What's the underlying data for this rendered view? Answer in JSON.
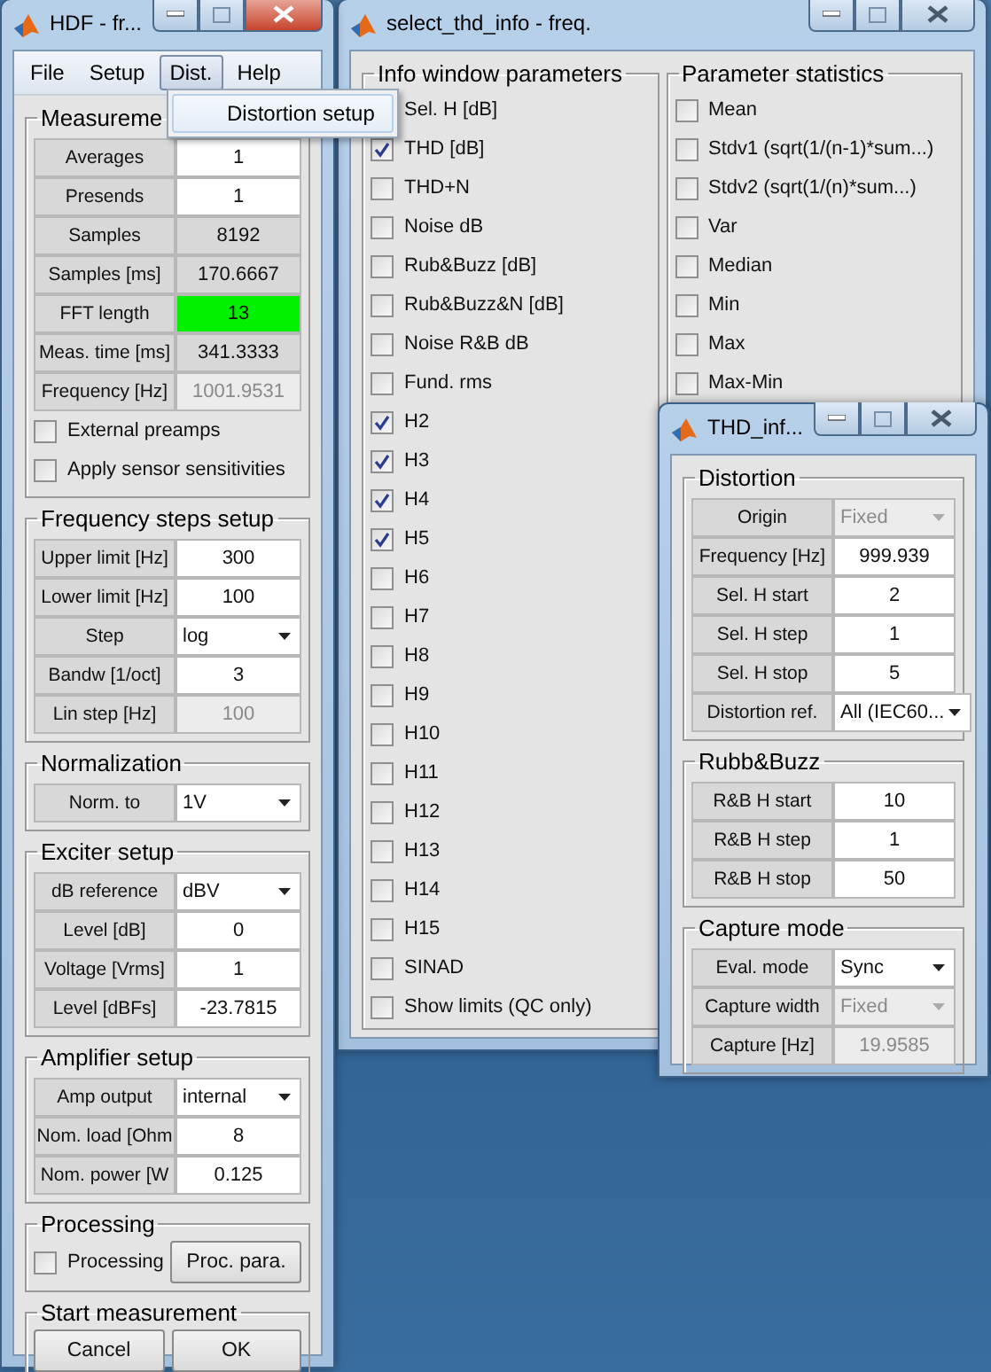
{
  "windows": [
    {
      "kind": "main",
      "title": "HDF - fr...",
      "active": true,
      "menu": [
        {
          "label": "File",
          "selected": false
        },
        {
          "label": "Setup",
          "selected": false
        },
        {
          "label": "Dist.",
          "selected": true
        },
        {
          "label": "Help",
          "selected": false
        }
      ],
      "dropdown": [
        "Distortion setup"
      ],
      "panels": [
        {
          "title": "Measureme",
          "items": [
            {
              "kind": "edit",
              "label": "Averages",
              "value": "1"
            },
            {
              "kind": "edit",
              "label": "Presends",
              "value": "1"
            },
            {
              "kind": "text",
              "label": "Samples",
              "value": "8192"
            },
            {
              "kind": "text",
              "label": "Samples [ms]",
              "value": "170.6667"
            },
            {
              "kind": "text",
              "label": "FFT length",
              "value": "13",
              "color": "#00f000"
            },
            {
              "kind": "text",
              "label": "Meas. time [ms]",
              "value": "341.3333"
            },
            {
              "kind": "disabled-edit",
              "label": "Frequency [Hz]",
              "value": "1001.9531"
            },
            {
              "kind": "checkbox",
              "label": "External preamps",
              "checked": false
            },
            {
              "kind": "checkbox",
              "label": "Apply sensor sensitivities",
              "checked": false
            }
          ]
        },
        {
          "title": "Frequency steps setup",
          "items": [
            {
              "kind": "edit",
              "label": "Upper limit [Hz]",
              "value": "300"
            },
            {
              "kind": "edit",
              "label": "Lower limit [Hz]",
              "value": "100"
            },
            {
              "kind": "popup",
              "label": "Step",
              "value": "log"
            },
            {
              "kind": "edit",
              "label": "Bandw [1/oct]",
              "value": "3"
            },
            {
              "kind": "disabled-edit",
              "label": "Lin step [Hz]",
              "value": "100"
            }
          ]
        },
        {
          "title": "Normalization",
          "items": [
            {
              "kind": "popup",
              "label": "Norm. to",
              "value": "1V"
            }
          ]
        },
        {
          "title": "Exciter setup",
          "items": [
            {
              "kind": "popup",
              "label": "dB reference",
              "value": "dBV"
            },
            {
              "kind": "edit",
              "label": "Level [dB]",
              "value": "0"
            },
            {
              "kind": "edit",
              "label": "Voltage [Vrms]",
              "value": "1"
            },
            {
              "kind": "edit",
              "label": "Level [dBFs]",
              "value": "-23.7815"
            }
          ]
        },
        {
          "title": "Amplifier setup",
          "items": [
            {
              "kind": "popup",
              "label": "Amp output",
              "value": "internal"
            },
            {
              "kind": "edit",
              "label": "Nom. load [Ohm",
              "value": "8"
            },
            {
              "kind": "edit",
              "label": "Nom. power [W",
              "value": "0.125"
            }
          ]
        },
        {
          "title": "Processing",
          "items": [
            {
              "kind": "checkbox",
              "label": "Processing",
              "checked": false
            },
            {
              "kind": "button",
              "label": "Proc. para."
            }
          ]
        },
        {
          "title": "Start measurement",
          "items": [
            {
              "kind": "button",
              "label": "Cancel"
            },
            {
              "kind": "button",
              "label": "OK"
            }
          ]
        }
      ]
    },
    {
      "kind": "checklist",
      "title": "select_thd_info - freq.",
      "active": false,
      "panels": [
        {
          "title": "Info window parameters",
          "items": [
            {
              "kind": "checkbox",
              "label": "Sel. H [dB]"
            },
            {
              "kind": "checkbox",
              "label": "THD [dB]",
              "checked": true
            },
            {
              "kind": "checkbox",
              "label": "THD+N",
              "checked": false
            },
            {
              "kind": "checkbox",
              "label": "Noise dB",
              "checked": false
            },
            {
              "kind": "checkbox",
              "label": "Rub&Buzz [dB]",
              "checked": false
            },
            {
              "kind": "checkbox",
              "label": "Rub&Buzz&N [dB]",
              "checked": false
            },
            {
              "kind": "checkbox",
              "label": "Noise R&B dB",
              "checked": false
            },
            {
              "kind": "checkbox",
              "label": "Fund. rms",
              "checked": false
            },
            {
              "kind": "checkbox",
              "label": "H2",
              "checked": true
            },
            {
              "kind": "checkbox",
              "label": "H3",
              "checked": true
            },
            {
              "kind": "checkbox",
              "label": "H4",
              "checked": true
            },
            {
              "kind": "checkbox",
              "label": "H5",
              "checked": true
            },
            {
              "kind": "checkbox",
              "label": "H6",
              "checked": false
            },
            {
              "kind": "checkbox",
              "label": "H7",
              "checked": false
            },
            {
              "kind": "checkbox",
              "label": "H8",
              "checked": false
            },
            {
              "kind": "checkbox",
              "label": "H9",
              "checked": false
            },
            {
              "kind": "checkbox",
              "label": "H10",
              "checked": false
            },
            {
              "kind": "checkbox",
              "label": "H11",
              "checked": false
            },
            {
              "kind": "checkbox",
              "label": "H12",
              "checked": false
            },
            {
              "kind": "checkbox",
              "label": "H13",
              "checked": false
            },
            {
              "kind": "checkbox",
              "label": "H14",
              "checked": false
            },
            {
              "kind": "checkbox",
              "label": "H15",
              "checked": false
            },
            {
              "kind": "checkbox",
              "label": "SINAD",
              "checked": false
            },
            {
              "kind": "checkbox",
              "label": "Show limits (QC only)",
              "checked": false
            }
          ]
        },
        {
          "title": "Parameter statistics",
          "items": [
            {
              "kind": "checkbox",
              "label": "Mean",
              "checked": false
            },
            {
              "kind": "checkbox",
              "label": "Stdv1 (sqrt(1/(n-1)*sum...)",
              "checked": false
            },
            {
              "kind": "checkbox",
              "label": "Stdv2 (sqrt(1/(n)*sum...)",
              "checked": false
            },
            {
              "kind": "checkbox",
              "label": "Var",
              "checked": false
            },
            {
              "kind": "checkbox",
              "label": "Median",
              "checked": false
            },
            {
              "kind": "checkbox",
              "label": "Min",
              "checked": false
            },
            {
              "kind": "checkbox",
              "label": "Max",
              "checked": false
            },
            {
              "kind": "checkbox",
              "label": "Max-Min",
              "checked": false
            }
          ]
        }
      ]
    },
    {
      "kind": "dialog",
      "title": "THD_inf...",
      "active": false,
      "panels": [
        {
          "title": "Distortion",
          "items": [
            {
              "kind": "disabled-popup",
              "label": "Origin",
              "value": "Fixed"
            },
            {
              "kind": "edit",
              "label": "Frequency [Hz]",
              "value": "999.939"
            },
            {
              "kind": "edit",
              "label": "Sel. H start",
              "value": "2"
            },
            {
              "kind": "edit",
              "label": "Sel. H step",
              "value": "1"
            },
            {
              "kind": "edit",
              "label": "Sel. H stop",
              "value": "5"
            },
            {
              "kind": "popup",
              "label": "Distortion ref.",
              "value": "All (IEC60..."
            }
          ]
        },
        {
          "title": "Rubb&Buzz",
          "items": [
            {
              "kind": "edit",
              "label": "R&B H start",
              "value": "10"
            },
            {
              "kind": "edit",
              "label": "R&B H step",
              "value": "1"
            },
            {
              "kind": "edit",
              "label": "R&B H stop",
              "value": "50"
            }
          ]
        },
        {
          "title": "Capture mode",
          "items": [
            {
              "kind": "popup",
              "label": "Eval. mode",
              "value": "Sync"
            },
            {
              "kind": "disabled-popup",
              "label": "Capture width",
              "value": "Fixed"
            },
            {
              "kind": "disabled-edit",
              "label": "Capture [Hz]",
              "value": "19.9585"
            }
          ]
        }
      ]
    }
  ]
}
